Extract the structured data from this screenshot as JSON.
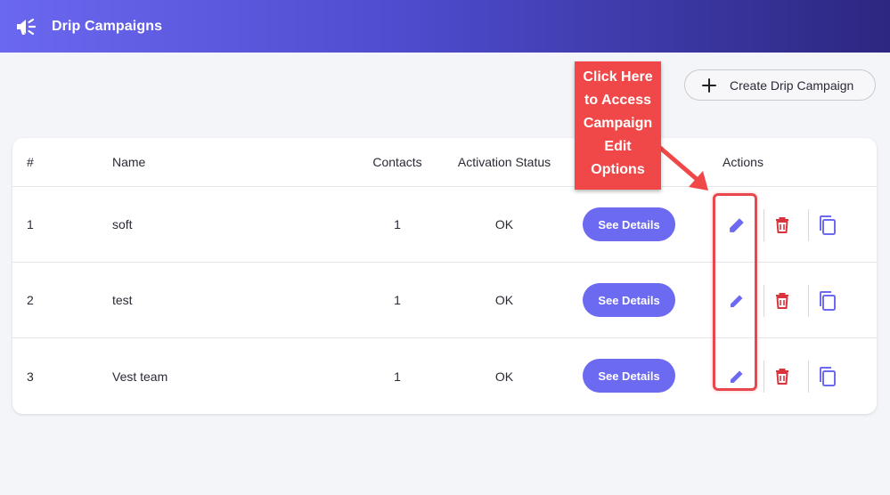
{
  "header": {
    "title": "Drip Campaigns",
    "logo_icon": "megaphone-icon"
  },
  "toolbar": {
    "create_label": "Create Drip Campaign",
    "create_icon": "plus-icon"
  },
  "table": {
    "columns": [
      "#",
      "Name",
      "Contacts",
      "Activation Status",
      "Actions"
    ],
    "rows": [
      {
        "num": "1",
        "name": "soft",
        "contacts": "1",
        "status": "OK",
        "details_label": "See Details"
      },
      {
        "num": "2",
        "name": "test",
        "contacts": "1",
        "status": "OK",
        "details_label": "See Details"
      },
      {
        "num": "3",
        "name": "Vest team",
        "contacts": "1",
        "status": "OK",
        "details_label": "See Details"
      }
    ],
    "action_icons": [
      "pencil-icon",
      "trash-icon",
      "copy-icon"
    ]
  },
  "annotation": {
    "callout_lines": [
      "Click Here",
      "to Access",
      "Campaign",
      "Edit",
      "Options"
    ]
  },
  "colors": {
    "header_start": "#6b68f0",
    "header_end": "#2c2780",
    "accent": "#6c6af0",
    "delete": "#d9343c",
    "annotation": "#f04849"
  }
}
